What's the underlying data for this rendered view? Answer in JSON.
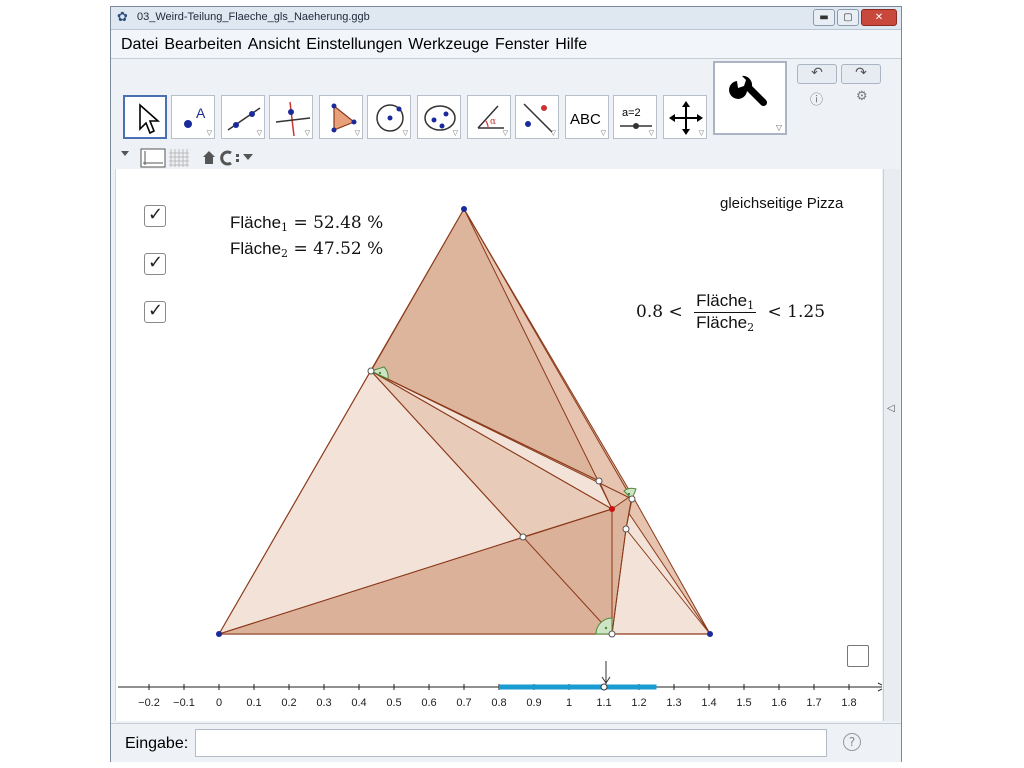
{
  "window": {
    "title": "03_Weird-Teilung_Flaeche_gls_Naeherung.ggb",
    "buttons": [
      "minimize",
      "maximize",
      "close"
    ]
  },
  "menubar": {
    "items": [
      "Datei",
      "Bearbeiten",
      "Ansicht",
      "Einstellungen",
      "Werkzeuge",
      "Fenster",
      "Hilfe"
    ]
  },
  "toolbar": {
    "tools": [
      {
        "name": "move",
        "icon": "pointer-icon"
      },
      {
        "name": "point",
        "icon": "point-icon"
      },
      {
        "name": "line",
        "icon": "line-icon"
      },
      {
        "name": "perpendicular",
        "icon": "perpendicular-icon"
      },
      {
        "name": "polygon",
        "icon": "polygon-icon"
      },
      {
        "name": "circle",
        "icon": "circle-icon"
      },
      {
        "name": "ellipse",
        "icon": "ellipse-icon"
      },
      {
        "name": "angle",
        "icon": "angle-icon"
      },
      {
        "name": "reflect",
        "icon": "reflect-icon"
      },
      {
        "name": "text",
        "icon": "text-icon",
        "label": "ABC"
      },
      {
        "name": "slider",
        "icon": "slider-icon",
        "label": "a=2"
      },
      {
        "name": "move-view",
        "icon": "move-view-icon"
      }
    ],
    "settings_icon": "wrench-icon",
    "undo_icon": "undo-icon",
    "redo_icon": "redo-icon",
    "help_icon": "help-icon",
    "gear_icon": "gear-icon"
  },
  "stylebar": {
    "icons": [
      "collapse-icon",
      "axes-icon",
      "grid-icon",
      "home-icon",
      "point-capture-icon"
    ]
  },
  "canvas": {
    "checkboxes": [
      {
        "checked": true
      },
      {
        "checked": true
      },
      {
        "checked": true
      }
    ],
    "area1": {
      "label": "Fläche",
      "sub": "1",
      "value": "= 52.48 %"
    },
    "area2": {
      "label": "Fläche",
      "sub": "2",
      "value": "= 47.52 %"
    },
    "heading": "gleichseitige Pizza",
    "ratio": {
      "lower": "0.8 <",
      "num": "Fläche",
      "num_sub": "1",
      "den": "Fläche",
      "den_sub": "2",
      "upper": "< 1.25"
    },
    "unchecked_box": {
      "checked": false
    },
    "axis": {
      "ticks": [
        "−0.2",
        "−0.1",
        "0",
        "0.1",
        "0.2",
        "0.3",
        "0.4",
        "0.5",
        "0.6",
        "0.7",
        "0.8",
        "0.9",
        "1",
        "1.1",
        "1.2",
        "1.3",
        "1.4",
        "1.5",
        "1.6",
        "1.7",
        "1.8"
      ],
      "tick_values": [
        -0.2,
        -0.1,
        0,
        0.1,
        0.2,
        0.3,
        0.4,
        0.5,
        0.6,
        0.7,
        0.8,
        0.9,
        1,
        1.1,
        1.2,
        1.3,
        1.4,
        1.5,
        1.6,
        1.7,
        1.8
      ],
      "slider_range": [
        0.8,
        1.25
      ],
      "slider_value": 1.1,
      "slider_color": "#1a9bd1"
    },
    "colors": {
      "fill": "#c98b6a",
      "stroke": "#8b3a1a",
      "vertex": "#1a2a9a",
      "red_point": "#cc1111",
      "angle_mark": "#4a8a3a"
    }
  },
  "inputbar": {
    "label": "Eingabe:",
    "value": "",
    "help_icon": "help-icon"
  }
}
